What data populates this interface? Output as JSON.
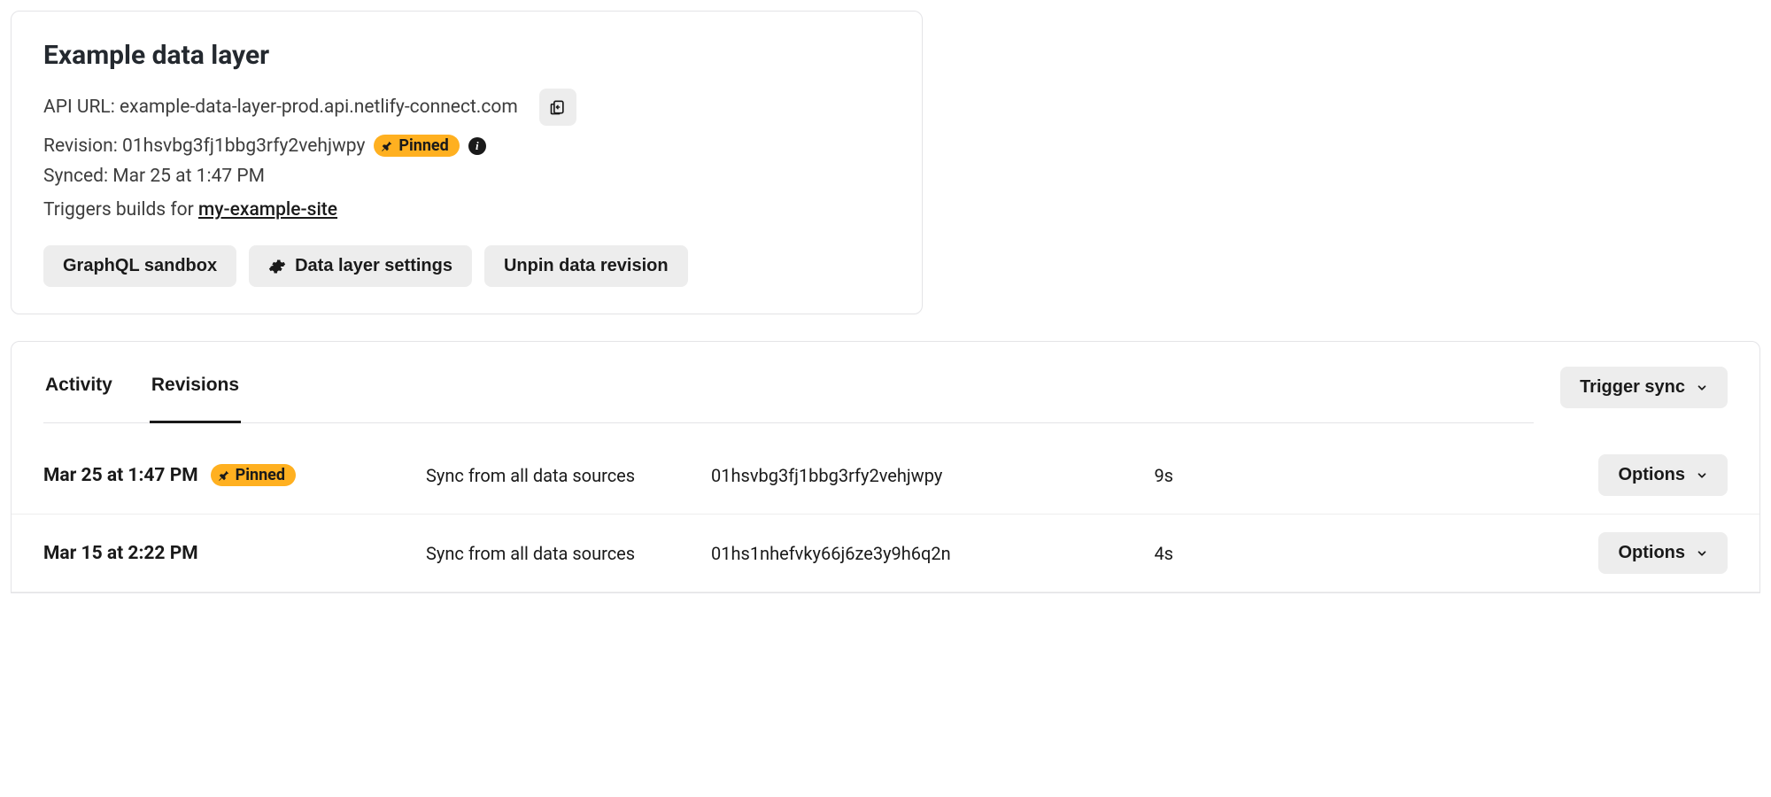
{
  "card": {
    "title": "Example data layer",
    "api_label": "API URL:",
    "api_value": "example-data-layer-prod.api.netlify-connect.com",
    "revision_label": "Revision:",
    "revision_value": "01hsvbg3fj1bbg3rfy2vehjwpy",
    "pinned_label": "Pinned",
    "synced_label": "Synced:",
    "synced_value": "Mar 25 at 1:47 PM",
    "triggers_prefix": "Triggers builds for",
    "triggers_site": "my-example-site",
    "buttons": {
      "graphql": "GraphQL sandbox",
      "settings": "Data layer settings",
      "unpin": "Unpin data revision"
    }
  },
  "panel": {
    "tabs": {
      "activity": "Activity",
      "revisions": "Revisions"
    },
    "trigger_sync": "Trigger sync",
    "options_label": "Options",
    "revisions": [
      {
        "time": "Mar 25 at 1:47 PM",
        "pinned": true,
        "source": "Sync from all data sources",
        "id": "01hsvbg3fj1bbg3rfy2vehjwpy",
        "duration": "9s"
      },
      {
        "time": "Mar 15 at 2:22 PM",
        "pinned": false,
        "source": "Sync from all data sources",
        "id": "01hs1nhefvky66j6ze3y9h6q2n",
        "duration": "4s"
      }
    ]
  }
}
